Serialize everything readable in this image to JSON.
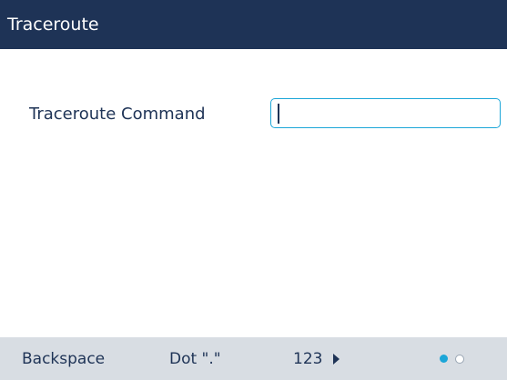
{
  "header": {
    "title": "Traceroute"
  },
  "form": {
    "traceroute_command": {
      "label": "Traceroute Command",
      "value": ""
    }
  },
  "softkeys": {
    "backspace": "Backspace",
    "dot": "Dot \".\"",
    "more": "123"
  },
  "pagination": {
    "current_page": 1,
    "total_pages": 2
  },
  "colors": {
    "header_background": "#1e3356",
    "accent": "#1ca6d8",
    "softkey_bar": "#d8dde3",
    "text": "#1e3356"
  }
}
